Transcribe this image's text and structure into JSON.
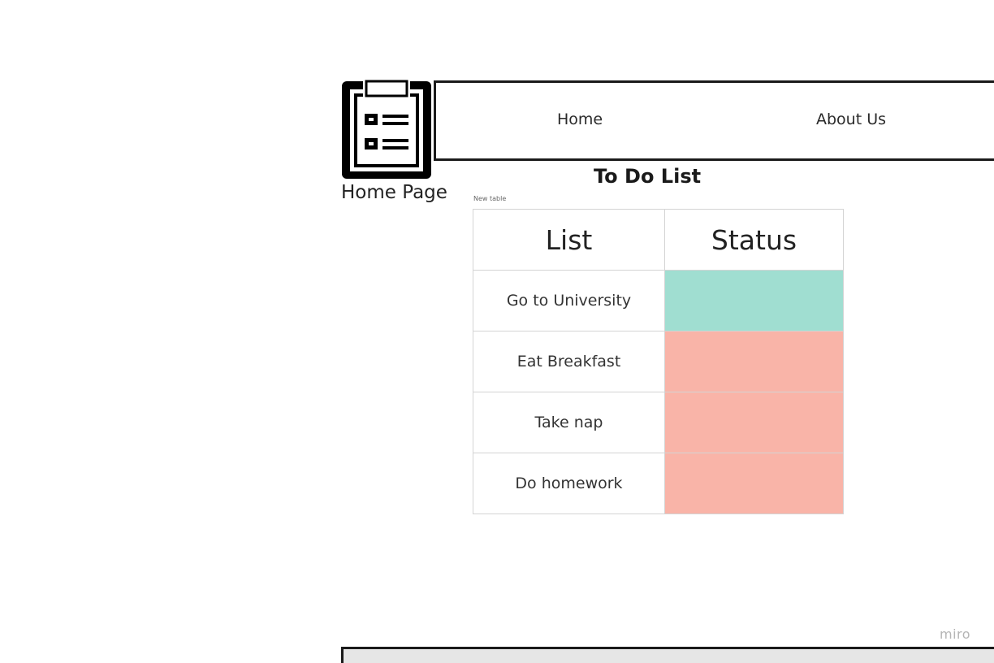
{
  "logo": {
    "icon": "clipboard-list-icon",
    "caption": "Home Page"
  },
  "nav": {
    "home_label": "Home",
    "about_label": "About Us"
  },
  "main": {
    "title": "To Do List",
    "table_caption": "New table",
    "table": {
      "headers": [
        "List",
        "Status"
      ],
      "rows": [
        {
          "item": "Go to University",
          "status": "done",
          "status_color": "#a0ded1"
        },
        {
          "item": "Eat Breakfast",
          "status": "pending",
          "status_color": "#f9b4a8"
        },
        {
          "item": "Take nap",
          "status": "pending",
          "status_color": "#f9b4a8"
        },
        {
          "item": "Do homework",
          "status": "pending",
          "status_color": "#f9b4a8"
        }
      ]
    }
  },
  "watermark": "miro",
  "colors": {
    "done": "#a0ded1",
    "pending": "#f9b4a8",
    "border": "#1a1a1a",
    "footer_bg": "#e6e6e6"
  }
}
